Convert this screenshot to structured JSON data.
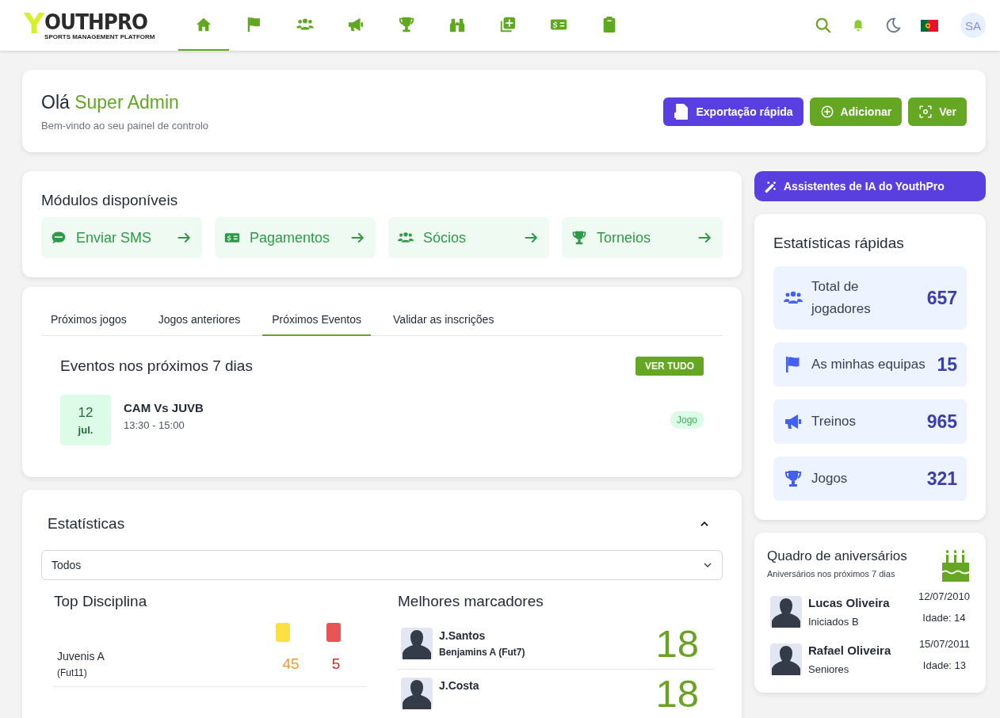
{
  "logo": {
    "initial": "Y",
    "name": "OUTHPRO",
    "tagline": "SPORTS MANAGEMENT PLATFORM"
  },
  "nav": [
    {
      "selected": true
    },
    {
      "selected": false
    },
    {
      "selected": false
    },
    {
      "selected": false
    },
    {
      "selected": false
    },
    {
      "selected": false
    },
    {
      "selected": false
    },
    {
      "selected": false
    },
    {
      "selected": false
    }
  ],
  "user_avatar": "SA",
  "welcome": {
    "greeting": "Olá",
    "name": "Super Admin",
    "subtitle": "Bem-vindo ao seu painel de controlo",
    "buttons": [
      "Exportação rápida",
      "Adicionar",
      "Ver"
    ]
  },
  "modules": {
    "title": "Módulos disponíveis",
    "items": [
      "Enviar SMS",
      "Pagamentos",
      "Sócios",
      "Torneios"
    ]
  },
  "tabs": [
    {
      "label": "Próximos jogos",
      "selected": false
    },
    {
      "label": "Jogos anteriores",
      "selected": false
    },
    {
      "label": "Próximos Eventos",
      "selected": true
    },
    {
      "label": "Validar as inscrições",
      "selected": false
    }
  ],
  "events": {
    "title": "Eventos nos próximos 7 dias",
    "view_all": "VER TUDO",
    "items": [
      {
        "day": "12",
        "month": "jul.",
        "title": "CAM Vs JUVB",
        "time": "13:30 - 15:00",
        "tag": "Jogo"
      }
    ]
  },
  "statistics": {
    "title": "Estatísticas",
    "expanded": true,
    "filter": "Todos",
    "discipline": {
      "title": "Top Disciplina",
      "rows": [
        {
          "team": "Juvenis A",
          "format": "(Fut11)",
          "yellow": "45",
          "red": "5"
        }
      ]
    },
    "scorers": {
      "title": "Melhores marcadores",
      "rows": [
        {
          "name": "J.Santos",
          "team": "Benjamins A (Fut7)",
          "goals": "18"
        },
        {
          "name": "J.Costa",
          "goals": "18"
        }
      ]
    }
  },
  "ai_button": "Assistentes de IA do YouthPro",
  "quick_stats": {
    "title": "Estatísticas rápidas",
    "items": [
      {
        "label": "Total de jogadores",
        "value": "657"
      },
      {
        "label": "As minhas equipas",
        "value": "15"
      },
      {
        "label": "Treinos",
        "value": "965"
      },
      {
        "label": "Jogos",
        "value": "321"
      }
    ]
  },
  "birthdays": {
    "title": "Quadro de aniversários",
    "subtitle": "Aniversários nos próximos 7 dias",
    "items": [
      {
        "name": "Lucas Oliveira",
        "team": "Iniciados B",
        "date": "12/07/2010",
        "age": "Idade: 14"
      },
      {
        "name": "Rafael Oliveira",
        "team": "Seniores",
        "date": "15/07/2011",
        "age": "Idade: 13"
      }
    ]
  }
}
